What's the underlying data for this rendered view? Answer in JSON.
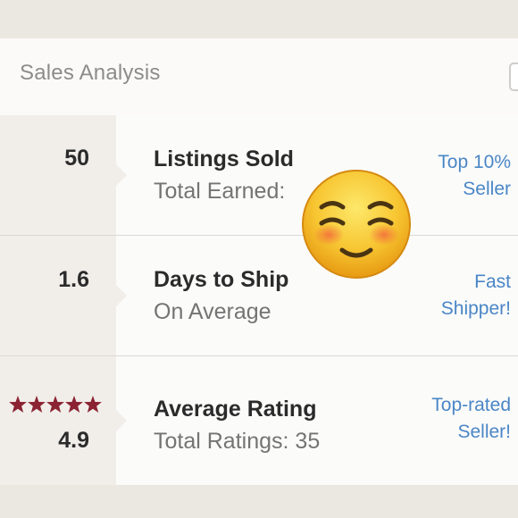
{
  "header": {
    "title": "Sales Analysis"
  },
  "rows": [
    {
      "stat": "50",
      "title": "Listings Sold",
      "subtitle": "Total Earned:",
      "badge_line1": "Top 10%",
      "badge_line2": "Seller"
    },
    {
      "stat": "1.6",
      "title": "Days to Ship",
      "subtitle": "On Average",
      "badge_line1": "Fast",
      "badge_line2": "Shipper!"
    },
    {
      "stat": "4.9",
      "rating_stars": 5,
      "title": "Average Rating",
      "subtitle": "Total Ratings: 35",
      "badge_line1": "Top-rated",
      "badge_line2": "Seller!"
    }
  ],
  "colors": {
    "badge_text": "#4a86c6",
    "star": "#8b2332",
    "stat_panel": "#f1eeea"
  },
  "icons": {
    "overlay": "smiling-blushing-face-emoji",
    "rating": "star-icon"
  }
}
